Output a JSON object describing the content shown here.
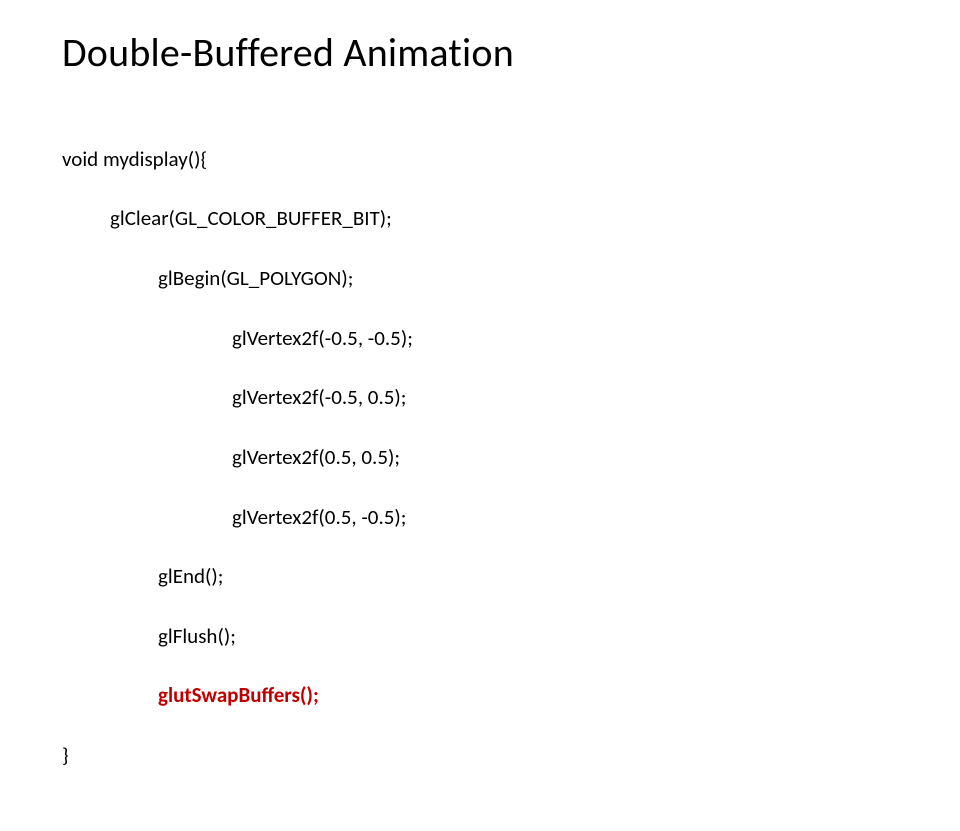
{
  "title": "Double-Buffered Animation",
  "code": {
    "l1": "void mydisplay(){",
    "l2": "glClear(GL_COLOR_BUFFER_BIT);",
    "l3": "glBegin(GL_POLYGON);",
    "l4": "glVertex2f(-0.5, -0.5);",
    "l5": "glVertex2f(-0.5, 0.5);",
    "l6": "glVertex2f(0.5, 0.5);",
    "l7": "glVertex2f(0.5, -0.5);",
    "l8": "glEnd();",
    "l9": "glFlush();",
    "l10": "glutSwapBuffers();",
    "l11": "}"
  }
}
